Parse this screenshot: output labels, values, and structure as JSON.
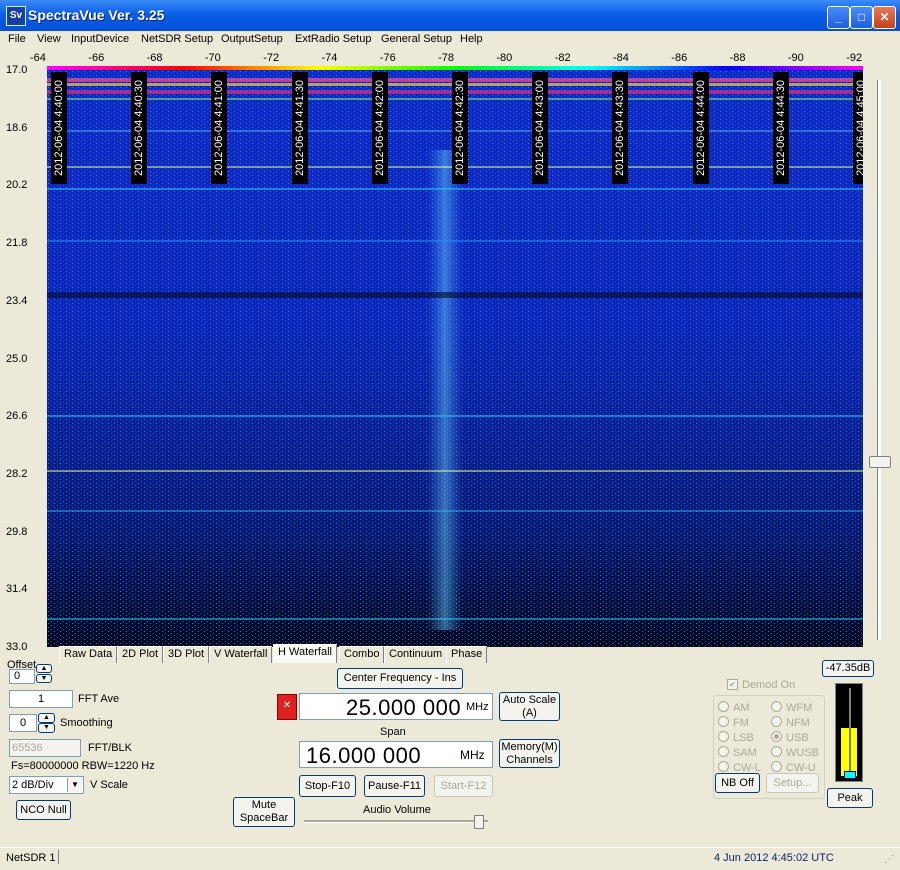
{
  "window": {
    "title": "SpectraVue Ver. 3.25",
    "icon_text": "Sv",
    "min": "_",
    "max": "□",
    "close": "✕"
  },
  "menu": [
    "File",
    "View",
    "InputDevice",
    "NetSDR Setup",
    "OutputSetup",
    "ExtRadio Setup",
    "General Setup",
    "Help"
  ],
  "x_axis": [
    "-64",
    "-66",
    "-68",
    "-70",
    "-72",
    "-74",
    "-76",
    "-78",
    "-80",
    "-82",
    "-84",
    "-86",
    "-88",
    "-90",
    "-92"
  ],
  "y_axis": [
    "17.0",
    "18.6",
    "20.2",
    "21.8",
    "23.4",
    "25.0",
    "26.6",
    "28.2",
    "29.8",
    "31.4",
    "33.0"
  ],
  "timestamps": [
    "2012-06-04 4:40:00",
    "2012-06-04 4:40:30",
    "2012-06-04 4:41:00",
    "2012-06-04 4:41:30",
    "2012-06-04 4:42:00",
    "2012-06-04 4:42:30",
    "2012-06-04 4:43:00",
    "2012-06-04 4:43:30",
    "2012-06-04 4:44:00",
    "2012-06-04 4:44:30",
    "2012-06-04 4:45:00"
  ],
  "tabs": [
    "Raw Data",
    "2D Plot",
    "3D Plot",
    "V Waterfall",
    "H Waterfall",
    "Combo",
    "Continuum",
    "Phase"
  ],
  "controls": {
    "offset_label": "Offset",
    "offset_value": "0",
    "fft_ave_value": "1",
    "fft_ave_label": "FFT Ave",
    "smoothing_value": "0",
    "smoothing_label": "Smoothing",
    "fft_blk_value": "65536",
    "fft_blk_label": "FFT/BLK",
    "fs_text": "Fs=80000000 RBW=1220 Hz",
    "vscale_value": "2 dB/Div",
    "vscale_label": "V Scale",
    "nco_null": "NCO Null",
    "mute": "Mute\nSpaceBar",
    "center_freq_button": "Center Frequency - Ins",
    "center_freq_value": "25.000 000",
    "freq_unit": "MHz",
    "span_label": "Span",
    "span_value": "16.000 000",
    "span_unit": "MHz",
    "auto_scale": "Auto Scale\n(A)",
    "memory": "Memory(M)\nChannels",
    "stop": "Stop-F10",
    "pause": "Pause-F11",
    "start": "Start-F12",
    "audio_volume": "Audio Volume",
    "demod_on": "Demod On",
    "modes_left": [
      "AM",
      "FM",
      "LSB",
      "SAM",
      "CW-L"
    ],
    "modes_right": [
      "WFM",
      "NFM",
      "USB",
      "WUSB",
      "CW-U"
    ],
    "selected_mode": "USB",
    "nb_off": "NB Off",
    "setup": "Setup...",
    "level_db": "-47.35dB",
    "peak": "Peak",
    "level_fraction": 0.55
  },
  "status": {
    "left": "NetSDR 1",
    "right": "4 Jun 2012  4:45:02 UTC"
  },
  "colors": {
    "accent": "#0a5ee8",
    "waterfall_bg": "#00103e",
    "level_fill": "#ffff00"
  }
}
